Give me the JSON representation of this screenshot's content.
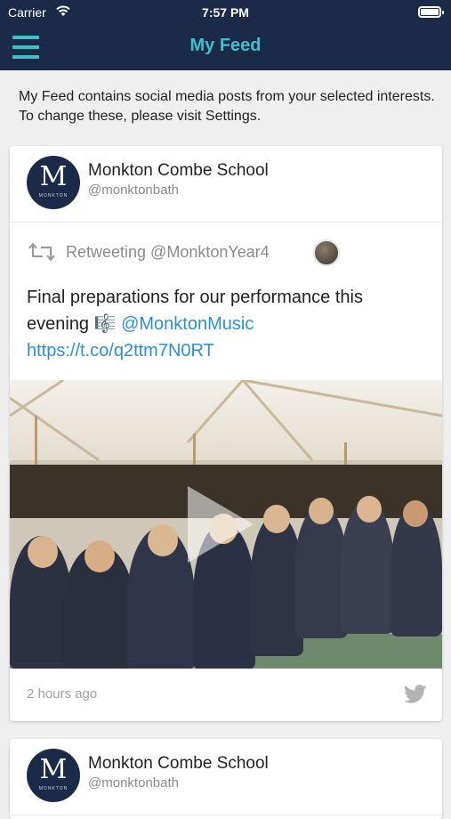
{
  "status_bar": {
    "carrier": "Carrier",
    "time": "7:57 PM"
  },
  "nav": {
    "title": "My Feed"
  },
  "intro_text": "My Feed contains social media posts from your selected interests. To change these, please visit Settings.",
  "posts": [
    {
      "account_name": "Monkton Combe School",
      "handle": "@monktonbath",
      "avatar_letter": "M",
      "avatar_wordmark": "MONKTON",
      "retweet_label": "Retweeting @MonktonYear4",
      "text_plain": "Final preparations for our performance this evening 🎼 ",
      "mention": "@MonktonMusic",
      "link": "https://t.co/q2ttm7N0RT",
      "time_ago": "2 hours ago",
      "source_icon": "twitter-icon"
    },
    {
      "account_name": "Monkton Combe School",
      "handle": "@monktonbath",
      "avatar_letter": "M",
      "avatar_wordmark": "MONKTON"
    }
  ],
  "colors": {
    "navy": "#1c2a4a",
    "teal": "#3fc0c9",
    "link": "#2a8fd6"
  }
}
